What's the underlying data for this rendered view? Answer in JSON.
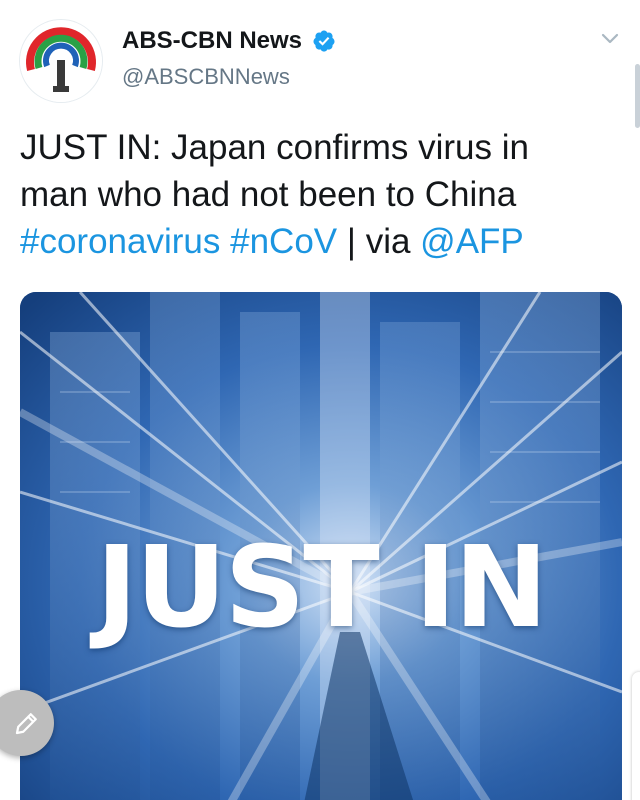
{
  "tweet": {
    "author": {
      "display_name": "ABS-CBN News",
      "handle": "@ABSCBNNews",
      "verified": true,
      "avatar_icon": "abs-cbn-logo-icon"
    },
    "text": {
      "line1": "JUST IN: Japan confirms virus in",
      "line2": "man who had not been to China",
      "hashtag1": "#coronavirus",
      "hashtag2": "#nCoV",
      "separator": " | via ",
      "mention": "@AFP"
    },
    "media": {
      "overlay_text": "JUST IN"
    },
    "menu_icon": "chevron-down-icon"
  },
  "compose_button": {
    "icon": "pencil-icon"
  },
  "colors": {
    "link": "#1b95e0",
    "verified": "#1da1f2",
    "text": "#14171a",
    "muted": "#657786",
    "media_blue": "#1a4b8c"
  }
}
